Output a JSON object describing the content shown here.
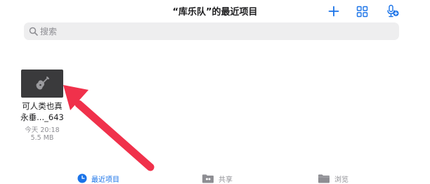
{
  "header": {
    "title": "“库乐队”的最近项目",
    "add_icon": "plus-icon",
    "grid_icon": "grid-view-icon",
    "mic_icon": "mic-add-icon"
  },
  "search": {
    "placeholder": "搜索",
    "value": ""
  },
  "files": [
    {
      "thumbnail_icon": "guitar-icon",
      "name_line1": "可人类也真",
      "name_line2": "永垂..._643",
      "date": "今天 20:18",
      "size": "5.5 MB"
    }
  ],
  "annotation": {
    "type": "red-arrow",
    "color": "#f0314b"
  },
  "tabs": [
    {
      "label": "最近项目",
      "icon": "clock-icon",
      "active": true
    },
    {
      "label": "共享",
      "icon": "shared-folder-icon",
      "active": false
    },
    {
      "label": "浏览",
      "icon": "folder-icon",
      "active": false
    }
  ],
  "colors": {
    "accent": "#1a73e8",
    "secondary_text": "#8e8e93",
    "search_bg": "#eeeeef"
  }
}
